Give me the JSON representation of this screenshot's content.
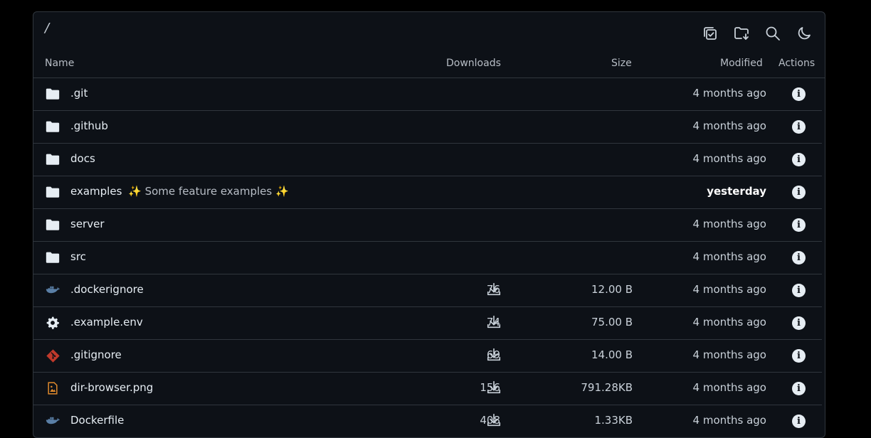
{
  "breadcrumb": "/",
  "toolbar": [
    {
      "icon": "select-multiple-icon"
    },
    {
      "icon": "folder-download-icon"
    },
    {
      "icon": "search-icon"
    },
    {
      "icon": "moon-icon"
    }
  ],
  "columns": {
    "name": "Name",
    "downloads": "Downloads",
    "size": "Size",
    "modified": "Modified",
    "actions": "Actions"
  },
  "rows": [
    {
      "type": "folder",
      "name": ".git",
      "desc": "",
      "downloads": "",
      "size": "",
      "modified": "4 months ago",
      "icon": "folder-icon"
    },
    {
      "type": "folder",
      "name": ".github",
      "desc": "",
      "downloads": "",
      "size": "",
      "modified": "4 months ago",
      "icon": "folder-icon"
    },
    {
      "type": "folder",
      "name": "docs",
      "desc": "",
      "downloads": "",
      "size": "",
      "modified": "4 months ago",
      "icon": "folder-icon"
    },
    {
      "type": "folder",
      "name": "examples",
      "desc": "Some feature examples",
      "downloads": "",
      "size": "",
      "modified": "yesterday",
      "icon": "folder-icon",
      "recent": true
    },
    {
      "type": "folder",
      "name": "server",
      "desc": "",
      "downloads": "",
      "size": "",
      "modified": "4 months ago",
      "icon": "folder-icon"
    },
    {
      "type": "folder",
      "name": "src",
      "desc": "",
      "downloads": "",
      "size": "",
      "modified": "4 months ago",
      "icon": "folder-icon"
    },
    {
      "type": "file",
      "name": ".dockerignore",
      "desc": "",
      "downloads": "76",
      "size": "12.00 B",
      "modified": "4 months ago",
      "icon": "docker-icon"
    },
    {
      "type": "file",
      "name": ".example.env",
      "desc": "",
      "downloads": "74",
      "size": "75.00 B",
      "modified": "4 months ago",
      "icon": "gear-icon"
    },
    {
      "type": "file",
      "name": ".gitignore",
      "desc": "",
      "downloads": "69",
      "size": "14.00 B",
      "modified": "4 months ago",
      "icon": "git-icon"
    },
    {
      "type": "file",
      "name": "dir-browser.png",
      "desc": "",
      "downloads": "156",
      "size": "791.28KB",
      "modified": "4 months ago",
      "icon": "image-icon"
    },
    {
      "type": "file",
      "name": "Dockerfile",
      "desc": "",
      "downloads": "408",
      "size": "1.33KB",
      "modified": "4 months ago",
      "icon": "docker-icon"
    }
  ],
  "colors": {
    "background": "#000000",
    "panel": "#0d1117",
    "border": "#30363d",
    "docker": "#5a7fa6",
    "git": "#c0392b",
    "image": "#e08a2c"
  }
}
